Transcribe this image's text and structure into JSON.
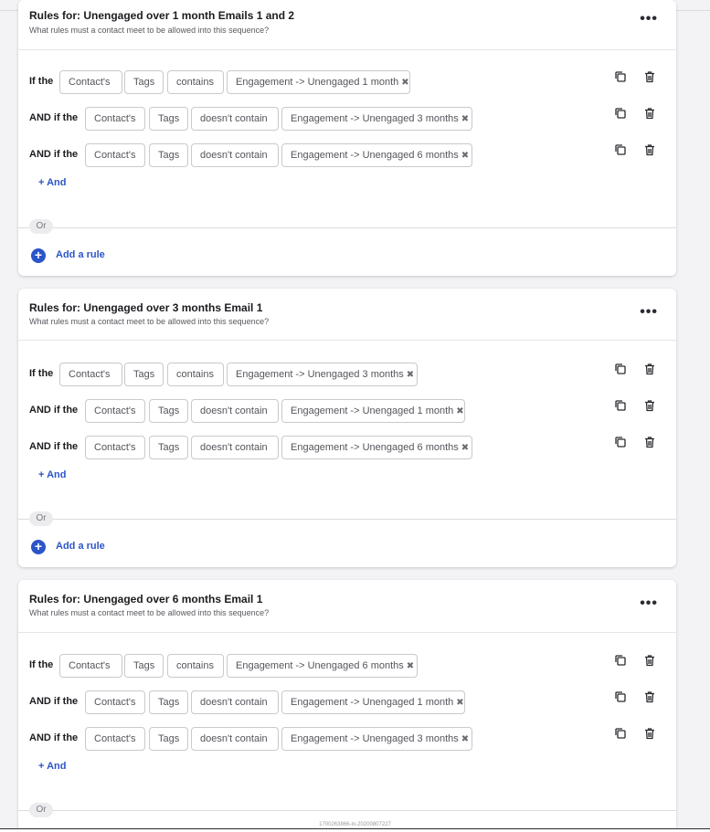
{
  "colors": {
    "accent": "#2b55c8",
    "pill_border": "#c9c9cf"
  },
  "icons": {
    "copy": "copy-icon",
    "delete": "trash-icon",
    "more": "more-icon",
    "add": "plus-circle-icon",
    "remove": "close-icon"
  },
  "cards": [
    {
      "title": "Rules for: Unengaged over 1 month Emails 1 and 2",
      "subtitle": "What rules must a contact meet to be allowed into this sequence?",
      "more_label": "•••",
      "rows": [
        {
          "lead": "If the",
          "subject": "Contact's",
          "field": "Tags",
          "operator": "contains",
          "value": "Engagement -> Unengaged 1 month",
          "remove": "✖"
        },
        {
          "lead": "AND if the",
          "subject": "Contact's",
          "field": "Tags",
          "operator": "doesn't contain",
          "value": "Engagement -> Unengaged 3 months",
          "remove": "✖"
        },
        {
          "lead": "AND if the",
          "subject": "Contact's",
          "field": "Tags",
          "operator": "doesn't contain",
          "value": "Engagement -> Unengaged 6 months",
          "remove": "✖"
        }
      ],
      "and_label": "+ And",
      "or_label": "Or",
      "add_rule_label": "Add a rule",
      "add_rule_plus": "+"
    },
    {
      "title": "Rules for: Unengaged over 3 months Email 1",
      "subtitle": "What rules must a contact meet to be allowed into this sequence?",
      "more_label": "•••",
      "rows": [
        {
          "lead": "If the",
          "subject": "Contact's",
          "field": "Tags",
          "operator": "contains",
          "value": "Engagement -> Unengaged 3 months",
          "remove": "✖"
        },
        {
          "lead": "AND if the",
          "subject": "Contact's",
          "field": "Tags",
          "operator": "doesn't contain",
          "value": "Engagement -> Unengaged 1 month",
          "remove": "✖"
        },
        {
          "lead": "AND if the",
          "subject": "Contact's",
          "field": "Tags",
          "operator": "doesn't contain",
          "value": "Engagement -> Unengaged 6 months",
          "remove": "✖"
        }
      ],
      "and_label": "+ And",
      "or_label": "Or",
      "add_rule_label": "Add a rule",
      "add_rule_plus": "+"
    },
    {
      "title": "Rules for: Unengaged over 6 months Email 1",
      "subtitle": "What rules must a contact meet to be allowed into this sequence?",
      "more_label": "•••",
      "rows": [
        {
          "lead": "If the",
          "subject": "Contact's",
          "field": "Tags",
          "operator": "contains",
          "value": "Engagement -> Unengaged 6 months",
          "remove": "✖"
        },
        {
          "lead": "AND if the",
          "subject": "Contact's",
          "field": "Tags",
          "operator": "doesn't contain",
          "value": "Engagement -> Unengaged 1 month",
          "remove": "✖"
        },
        {
          "lead": "AND if the",
          "subject": "Contact's",
          "field": "Tags",
          "operator": "doesn't contain",
          "value": "Engagement -> Unengaged 3 months",
          "remove": "✖"
        }
      ],
      "and_label": "+ And",
      "or_label": "Or"
    }
  ],
  "footer_text": "1700263866-in-20200807227"
}
